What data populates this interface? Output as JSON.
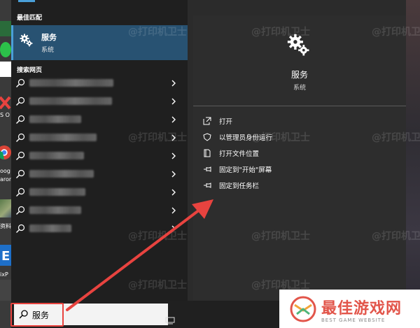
{
  "search_panel": {
    "best_match_heading": "最佳匹配",
    "best_match": {
      "title": "服务",
      "subtitle": "系统",
      "icon": "gears-icon"
    },
    "web_heading": "搜索网页",
    "web_results_count": 9
  },
  "detail_panel": {
    "title": "服务",
    "subtitle": "系统",
    "actions": [
      {
        "label": "打开",
        "icon": "open-icon"
      },
      {
        "label": "以管理员身份运行",
        "icon": "shield-icon"
      },
      {
        "label": "打开文件位置",
        "icon": "file-location-icon"
      },
      {
        "label": "固定到\"开始\"屏幕",
        "icon": "pin-icon"
      },
      {
        "label": "固定到任务栏",
        "icon": "pin-icon"
      }
    ]
  },
  "desktop_labels": {
    "l1": "S O",
    "l2": "oog",
    "l3": "aron",
    "l4": "资料",
    "l5": "ixP"
  },
  "taskbar": {
    "search_value": "服务"
  },
  "watermark": "@打印机卫士",
  "badge": {
    "name": "最佳游戏网",
    "subtitle": "BEST GAME WEBSITE"
  },
  "colors": {
    "accent": "#4a9fd8",
    "best_match_bg": "#285272",
    "annotation_red": "#e8433f"
  }
}
